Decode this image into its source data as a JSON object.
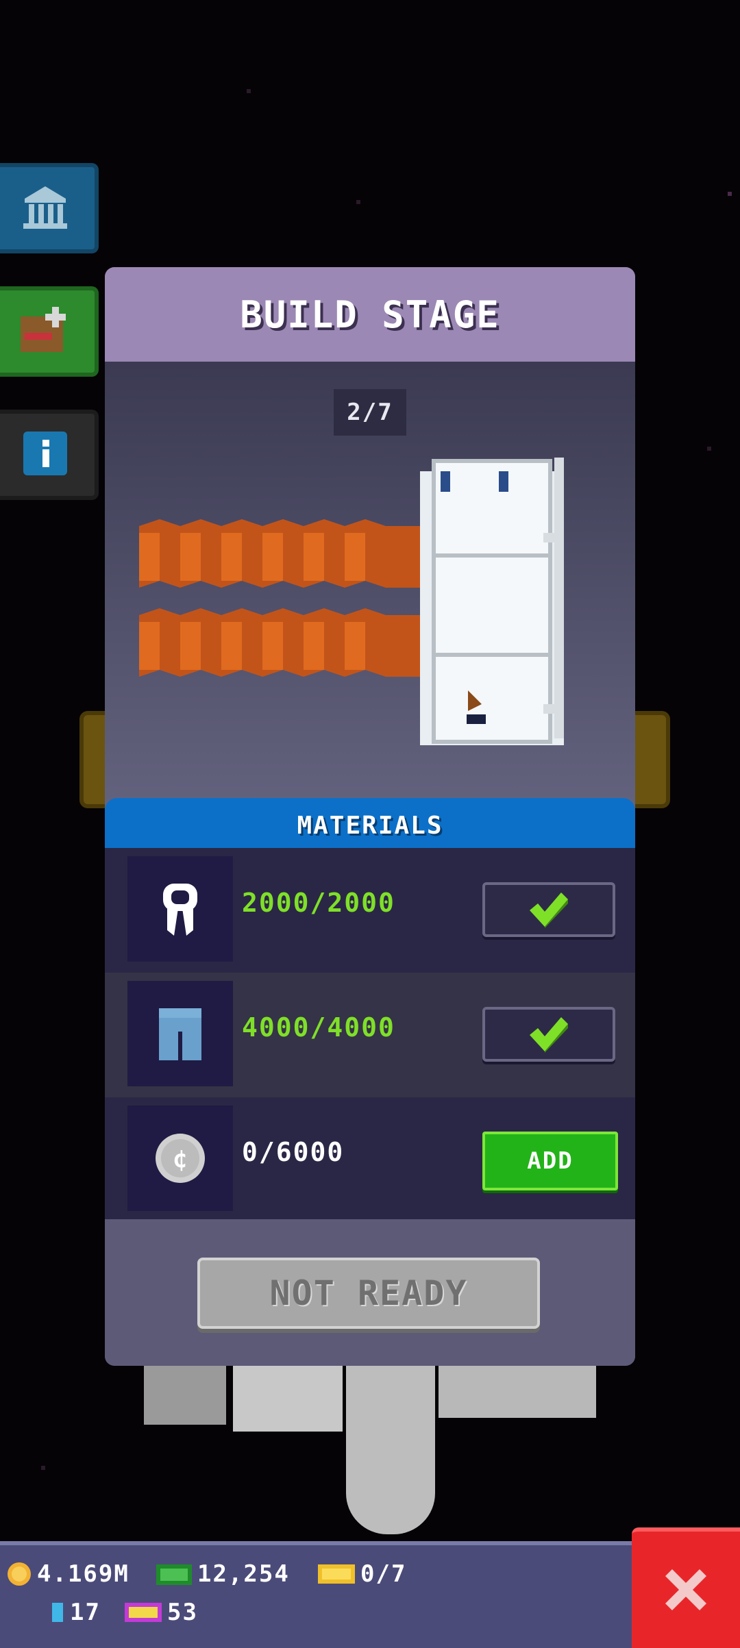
{
  "modal": {
    "title": "BUILD STAGE",
    "stage_counter": "2/7",
    "materials_title": "MATERIALS",
    "materials": [
      {
        "icon": "ribbon-icon",
        "amount": "2000/2000",
        "complete": true
      },
      {
        "icon": "jeans-icon",
        "amount": "4000/4000",
        "complete": true
      },
      {
        "icon": "coin-icon",
        "amount": "0/6000",
        "complete": false,
        "button_label": "ADD"
      }
    ],
    "primary_button": "NOT READY"
  },
  "resources": {
    "coins": "4.169M",
    "bux": "12,254",
    "tickets": "0/7",
    "bits": "17",
    "vip": "53"
  },
  "colors": {
    "header": "#9b88b4",
    "materials_header": "#0c70c8",
    "complete_text": "#7fe028",
    "add_button": "#22b319",
    "close_button": "#e8262a"
  }
}
